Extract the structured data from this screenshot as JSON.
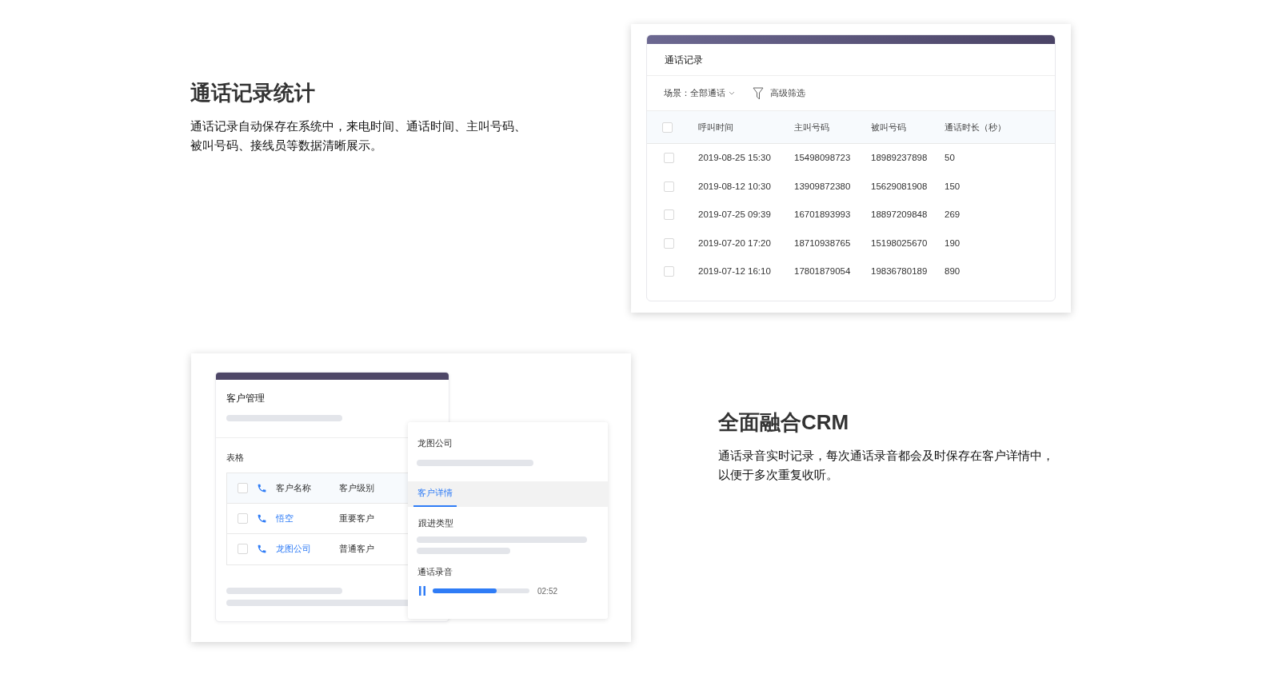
{
  "call_records_section": {
    "title": "通话记录统计",
    "description": "通话记录自动保存在系统中，来电时间、通话时间、主叫号码、被叫号码、接线员等数据清晰展示。",
    "card": {
      "title": "通话记录",
      "scene_label": "场景：",
      "scene_value": "全部通话",
      "filter_label": "高级筛选",
      "columns": [
        "呼叫时间",
        "主叫号码",
        "被叫号码",
        "通话时长（秒）"
      ],
      "header_checked": false,
      "rows": [
        {
          "checked": false,
          "cells": [
            "2019-08-25 15:30",
            "15498098723",
            "18989237898",
            "50"
          ]
        },
        {
          "checked": false,
          "cells": [
            "2019-08-12 10:30",
            "13909872380",
            "15629081908",
            "150"
          ]
        },
        {
          "checked": false,
          "cells": [
            "2019-07-25 09:39",
            "16701893993",
            "18897209848",
            "269"
          ]
        },
        {
          "checked": false,
          "cells": [
            "2019-07-20 17:20",
            "18710938765",
            "15198025670",
            "190"
          ]
        },
        {
          "checked": false,
          "cells": [
            "2019-07-12 16:10",
            "17801879054",
            "19836780189",
            "890"
          ]
        }
      ]
    }
  },
  "crm_section": {
    "title": "全面融合CRM",
    "description": "通话录音实时记录，每次通话录音都会及时保存在客户详情中，以便于多次重复收听。",
    "customer_panel": {
      "title": "客户管理",
      "table_label": "表格",
      "columns": [
        "客户名称",
        "客户级别"
      ],
      "header_checked": false,
      "rows": [
        {
          "checked": false,
          "name": "悟空",
          "level_text": "重要客户"
        },
        {
          "checked": false,
          "name": "龙图公司",
          "level_text": "普通客户"
        }
      ]
    },
    "detail_panel": {
      "title": "龙图公司",
      "tabs": [
        {
          "label": "客户详情",
          "selected": true
        }
      ],
      "follow_label": "跟进类型",
      "recording_label": "通话录音",
      "playing": true,
      "level": 0.66,
      "time": "02:52"
    }
  }
}
